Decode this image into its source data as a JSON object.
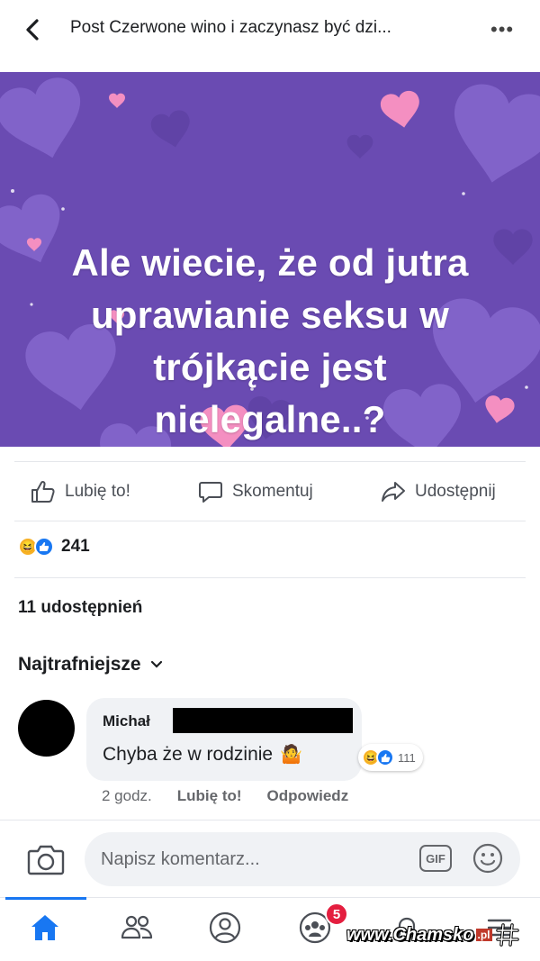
{
  "header": {
    "title": "Post Czerwone wino i zaczynasz być dzi...",
    "more": "•••"
  },
  "post": {
    "image_text_lines": [
      "Ale wiecie, że od jutra",
      "uprawianie seksu w",
      "trójkącie jest",
      "nielegalne..?"
    ],
    "background_color": "#6a4bb2"
  },
  "actions": {
    "like": "Lubię to!",
    "comment": "Skomentuj",
    "share": "Udostępnij"
  },
  "reactions": {
    "count": "241",
    "types": [
      "haha",
      "like"
    ]
  },
  "shares": "11 udostępnień",
  "sort": {
    "label": "Najtrafniejsze"
  },
  "comment": {
    "author": "Michał",
    "text": "Chyba że w rodzinie",
    "reaction_count": "111",
    "time": "2 godz.",
    "like": "Lubię to!",
    "reply": "Odpowiedz"
  },
  "composer": {
    "placeholder": "Napisz komentarz...",
    "gif": "GIF"
  },
  "nav": {
    "badge": "5"
  },
  "watermark": {
    "text": "www.Chamsko",
    "tld": ".pl"
  },
  "colors": {
    "accent": "#1877f2",
    "badge": "#e41e3f",
    "muted": "#65676b"
  }
}
